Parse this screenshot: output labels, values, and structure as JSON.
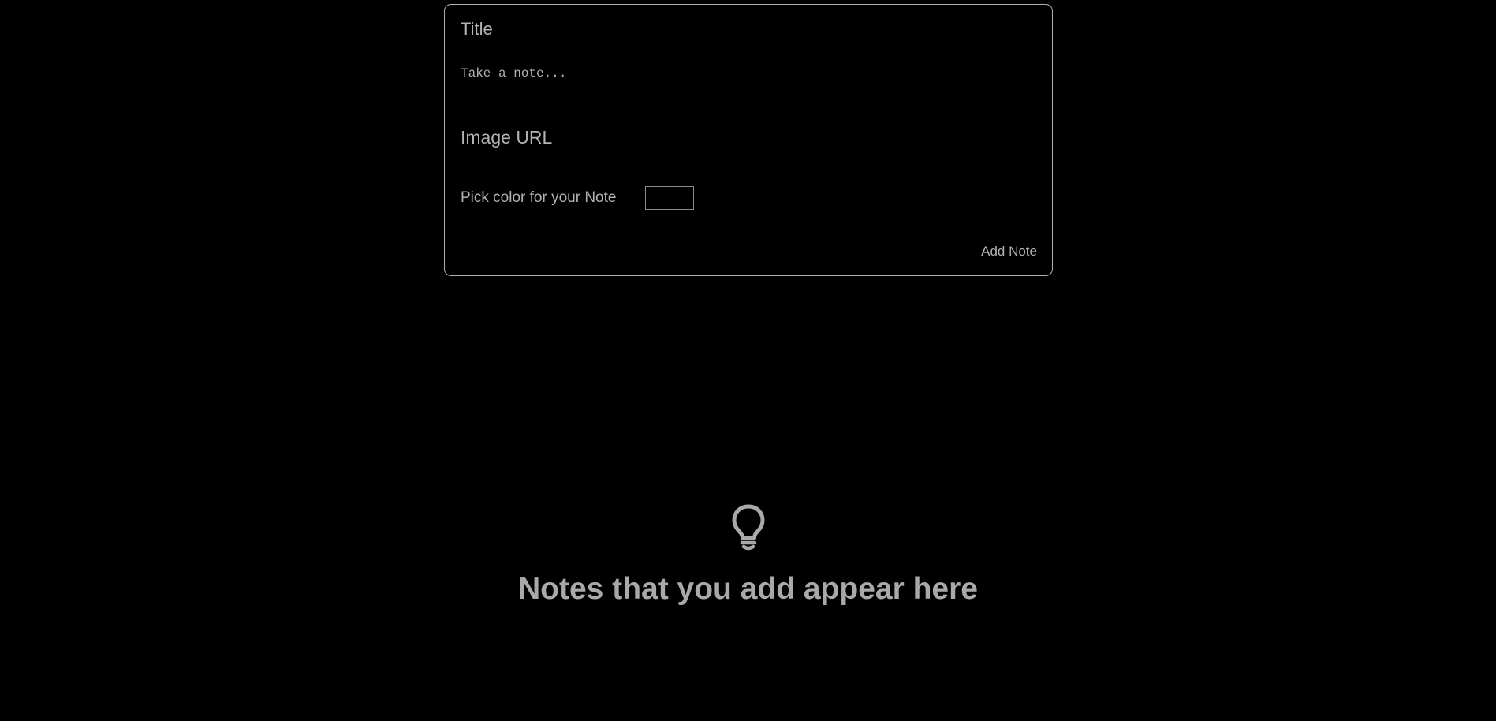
{
  "form": {
    "title_placeholder": "Title",
    "note_placeholder": "Take a note...",
    "image_url_placeholder": "Image URL",
    "color_label": "Pick color for your Note",
    "color_value": "#000000",
    "add_button_label": "Add Note"
  },
  "empty_state": {
    "icon": "lightbulb-icon",
    "message": "Notes that you add appear here"
  },
  "colors": {
    "background": "#000000",
    "text": "#b3b3b3",
    "border": "#b0b0b0"
  }
}
